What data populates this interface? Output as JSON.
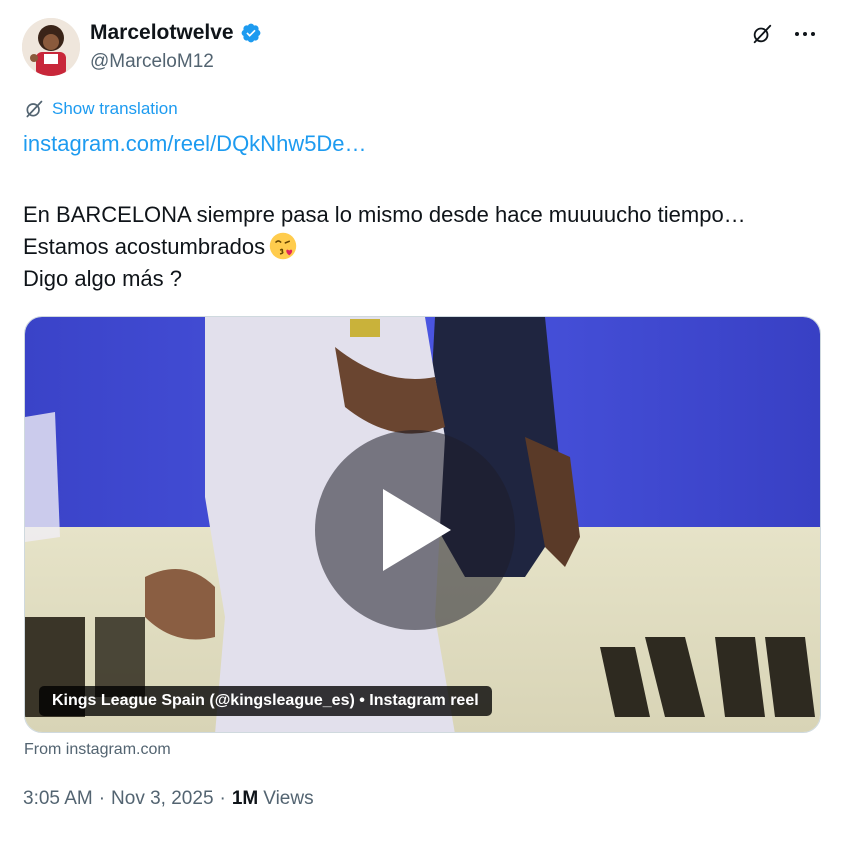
{
  "author": {
    "display_name": "Marcelotwelve",
    "handle": "@MarceloM12",
    "verified": true,
    "verified_color": "#1d9bf0"
  },
  "actions": {
    "grok_icon": "grok-icon",
    "more_icon": "more-icon"
  },
  "translation": {
    "label": "Show translation"
  },
  "tweet": {
    "link": "instagram.com/reel/DQkNhw5De…",
    "lines": [
      "En BARCELONA siempre pasa lo mismo desde hace muuuucho tiempo…",
      "Estamos acostumbrados",
      "Digo algo más ?"
    ],
    "emoji": "face-blowing-kiss"
  },
  "media": {
    "caption": "Kings League Spain (@kingsleague_es) • Instagram reel",
    "source": "From instagram.com"
  },
  "meta": {
    "time": "3:05 AM",
    "date": "Nov 3, 2025",
    "separator": "·",
    "views_count": "1M",
    "views_label": "Views"
  },
  "colors": {
    "link": "#1d9bf0",
    "secondary_text": "#536471",
    "primary_text": "#0f1419"
  }
}
